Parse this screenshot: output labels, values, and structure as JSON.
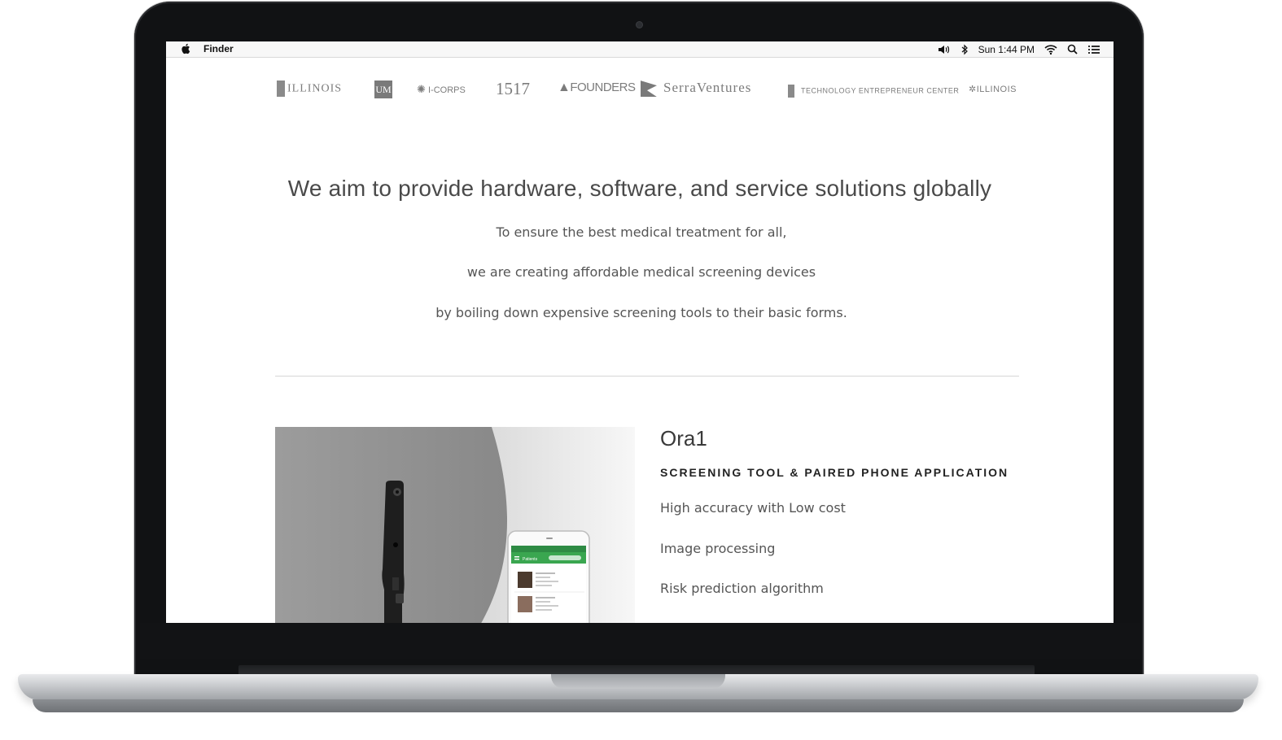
{
  "menubar": {
    "app_name": "Finder",
    "clock": "Sun 1:44 PM",
    "icons": [
      "apple-icon",
      "volume-icon",
      "bluetooth-icon",
      "wifi-icon",
      "search-icon",
      "list-icon"
    ]
  },
  "logos": [
    {
      "name": "illinois-logo",
      "text": "ILLINOIS"
    },
    {
      "name": "um-logo",
      "text": "UM"
    },
    {
      "name": "i-corps-logo",
      "text": "I-CORPS"
    },
    {
      "name": "1517-logo",
      "text": "1517"
    },
    {
      "name": "founders-logo",
      "text": "FOUNDERS"
    },
    {
      "name": "serraventures-logo",
      "text": "SerraVentures"
    },
    {
      "name": "tec-logo",
      "text": "TECHNOLOGY ENTREPRENEUR CENTER"
    },
    {
      "name": "illinois-ventures-logo",
      "text": "ILLINOIS"
    }
  ],
  "hero": {
    "headline": "We aim to provide hardware, software, and service solutions globally",
    "lines": [
      "To ensure the best medical treatment for all,",
      "we are creating affordable medical screening devices",
      "by boiling down expensive screening tools to their basic forms."
    ]
  },
  "product": {
    "title": "Ora1",
    "subtitle": "SCREENING TOOL & PAIRED PHONE APPLICATION",
    "features": [
      "High accuracy with Low cost",
      "Image processing",
      "Risk prediction algorithm"
    ],
    "phone_app_header": "Patients"
  },
  "colors": {
    "app_green": "#3aa650",
    "text_dark": "#4a4a4a",
    "laptop_bezel": "#111214"
  }
}
